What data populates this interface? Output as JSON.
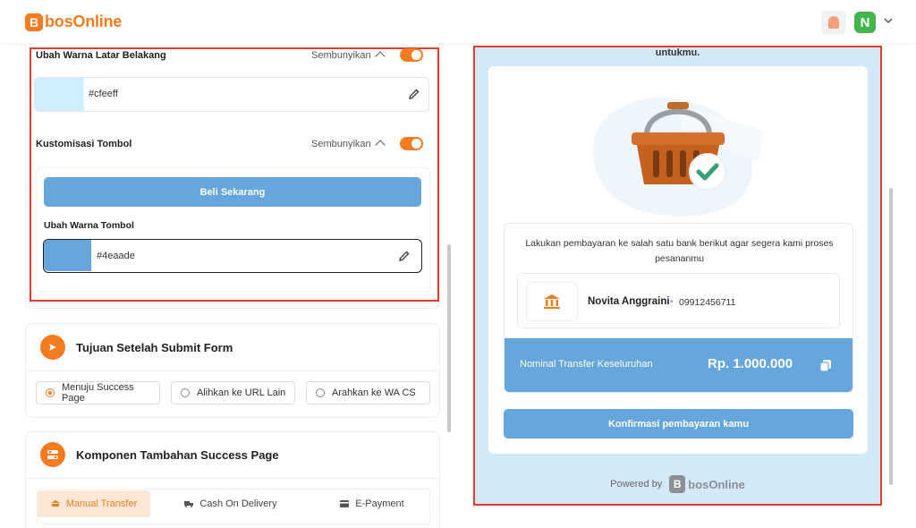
{
  "header": {
    "logo_letter": "B",
    "logo_text": "bosOnline",
    "avatar_initial": "N"
  },
  "bg_section": {
    "label": "Ubah Warna Latar Belakang",
    "toggle_text": "Sembunyikan",
    "hex": "#cfeeff",
    "swatch_color": "#cfeeff"
  },
  "button_section": {
    "label": "Kustomisasi Tombol",
    "toggle_text": "Sembunyikan",
    "preview_label": "Beli Sekarang",
    "color_label": "Ubah Warna Tombol",
    "hex": "#4eaade",
    "swatch_color": "#65a6dc"
  },
  "redirect_section": {
    "title": "Tujuan Setelah Submit Form",
    "options": [
      {
        "label": "Menuju Success Page",
        "selected": true
      },
      {
        "label": "Alihkan ke URL Lain",
        "selected": false
      },
      {
        "label": "Arahkan ke WA CS",
        "selected": false
      }
    ]
  },
  "components_section": {
    "title": "Komponen Tambahan Success Page",
    "tabs": [
      "Manual Transfer",
      "Cash On Delivery",
      "E-Payment"
    ]
  },
  "preview": {
    "top_text": "untukmu.",
    "bank_message": "Lakukan pembayaran ke salah satu bank berikut agar segera kami proses pesananmu",
    "account_name": "Novita Anggraini",
    "account_separator": "•",
    "account_number": "09912456711",
    "total_label": "Nominal Transfer Keseluruhan",
    "total_amount": "Rp. 1.000.000",
    "confirm_label": "Konfirmasi pembayaran kamu",
    "powered_by": "Powered by",
    "powered_logo_letter": "B",
    "powered_logo_text": "bosOnline"
  },
  "colors": {
    "brand": "#f47b20",
    "button_blue": "#65a6dc",
    "preview_bg": "#d4e9f8",
    "highlight_border": "#e03d2f"
  }
}
